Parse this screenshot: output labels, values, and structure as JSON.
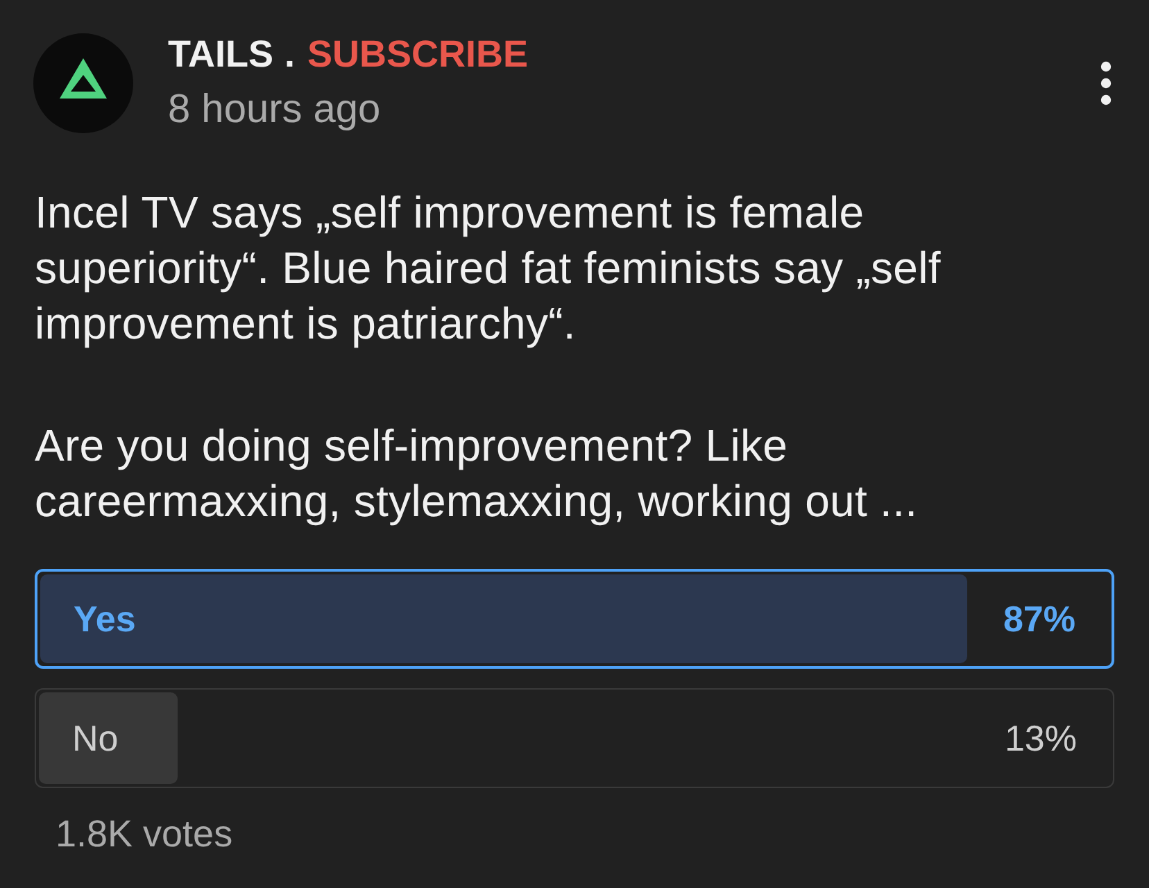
{
  "post": {
    "author": "TAILS",
    "separator": ".",
    "subscribe": "SUBSCRIBE",
    "time": "8 hours ago",
    "paragraphs": [
      "Incel TV says „self improvement is female superiority“. Blue haired fat feminists say „self improvement is patriarchy“.",
      "Are you doing self-improvement? Like careermaxxing, stylemaxxing, working out ..."
    ]
  },
  "poll": {
    "options": [
      {
        "label": "Yes",
        "percent": "87%",
        "level": 0.87,
        "selected": true
      },
      {
        "label": "No",
        "percent": "13%",
        "level": 0.13,
        "selected": false
      }
    ],
    "votes": "1.8K votes"
  }
}
